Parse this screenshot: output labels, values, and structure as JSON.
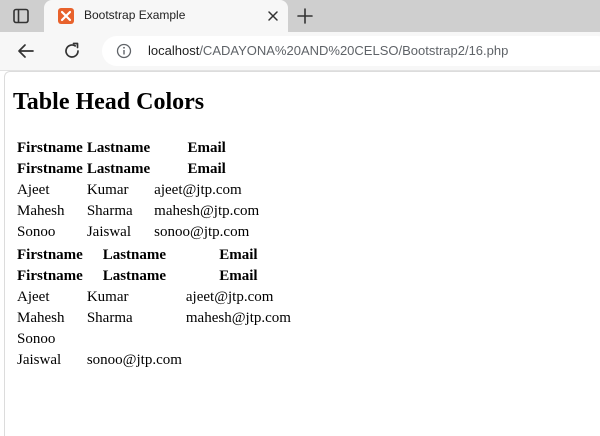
{
  "browser": {
    "tab_title": "Bootstrap Example",
    "url_host": "localhost",
    "url_path": "/CADAYONA%20AND%20CELSO/Bootstrap2/16.php"
  },
  "page": {
    "heading": "Table Head Colors",
    "table1": {
      "header_rows": [
        [
          "Firstname",
          "Lastname",
          "Email"
        ],
        [
          "Firstname",
          "Lastname",
          "Email"
        ]
      ],
      "rows": [
        [
          "Ajeet",
          "Kumar",
          "ajeet@jtp.com"
        ],
        [
          "Mahesh",
          "Sharma",
          "mahesh@jtp.com"
        ],
        [
          "Sonoo",
          "Jaiswal",
          "sonoo@jtp.com"
        ]
      ]
    },
    "table2": {
      "header_rows": [
        [
          "Firstname",
          "Lastname",
          "Email"
        ],
        [
          "Firstname",
          "Lastname",
          "Email"
        ]
      ],
      "rows": [
        [
          "Ajeet",
          "Kumar",
          "ajeet@jtp.com"
        ],
        [
          "Mahesh",
          "Sharma",
          "mahesh@jtp.com"
        ],
        [
          "Sonoo"
        ],
        [
          "Jaiswal",
          "sonoo@jtp.com"
        ]
      ]
    }
  }
}
